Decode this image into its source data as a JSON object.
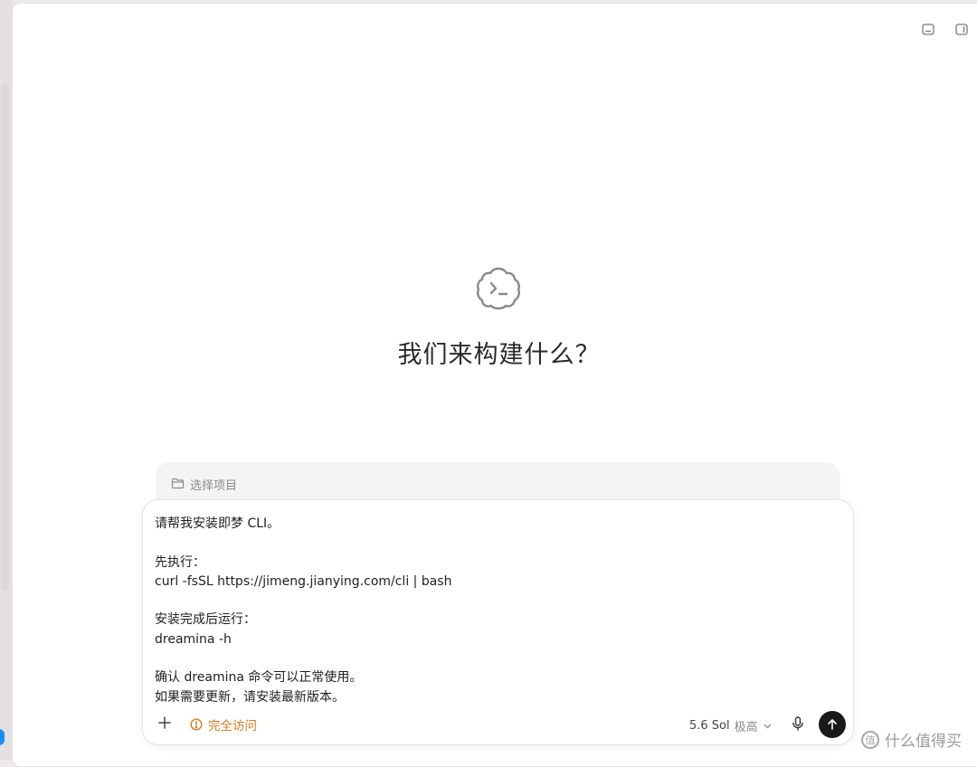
{
  "hero": {
    "heading": "我们来构建什么？"
  },
  "project": {
    "placeholder": "选择项目",
    "icon": "folder-icon"
  },
  "composer": {
    "prompt_text": "请帮我安装即梦 CLI。\n\n先执行：\ncurl -fsSL https://jimeng.jianying.com/cli | bash\n\n安装完成后运行：\ndreamina -h\n\n确认 dreamina 命令可以正常使用。\n如果需要更新，请安装最新版本。",
    "access_label": "完全访问",
    "model_label": "5.6 Sol",
    "effort_label": "极高"
  },
  "watermark": {
    "text": "什么值得买",
    "mark": "值"
  },
  "colors": {
    "access": "#e0781c",
    "send_button": "#1a1a1a"
  }
}
